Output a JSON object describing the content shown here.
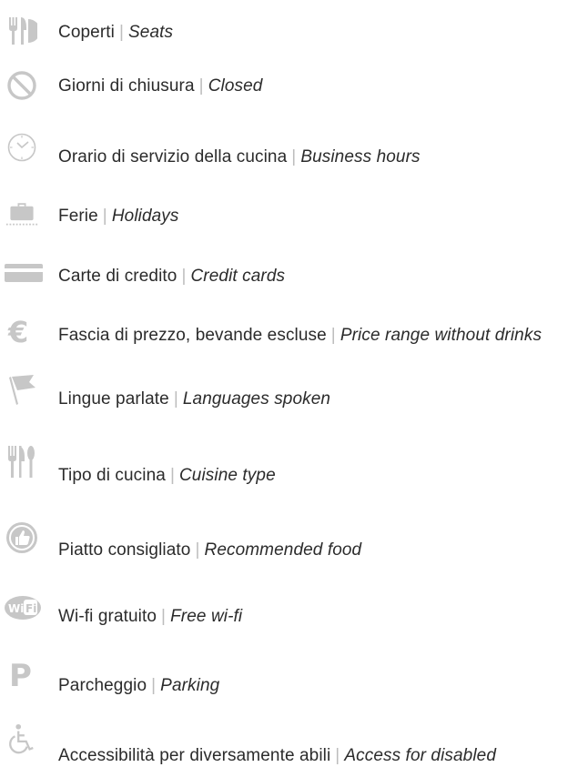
{
  "colors": {
    "icon": "#c7c7c7",
    "text": "#2b2b2b",
    "separator": "#bdbdbd"
  },
  "legend": [
    {
      "icon": "fork-knife-plate-icon",
      "it": "Coperti",
      "en": "Seats"
    },
    {
      "icon": "no-entry-icon",
      "it": "Giorni di chiusura",
      "en": "Closed"
    },
    {
      "icon": "clock-icon",
      "it": "Orario di servizio della cucina",
      "en": "Business hours"
    },
    {
      "icon": "suitcase-icon",
      "it": "Ferie",
      "en": "Holidays"
    },
    {
      "icon": "credit-card-icon",
      "it": "Carte di credito",
      "en": "Credit cards"
    },
    {
      "icon": "euro-icon",
      "it": "Fascia di prezzo, bevande escluse",
      "en": "Price range without drinks"
    },
    {
      "icon": "flag-icon",
      "it": "Lingue parlate",
      "en": "Languages spoken"
    },
    {
      "icon": "cutlery-icon",
      "it": "Tipo di cucina",
      "en": "Cuisine type"
    },
    {
      "icon": "thumbs-up-icon",
      "it": "Piatto consigliato",
      "en": "Recommended food"
    },
    {
      "icon": "wifi-icon",
      "it": "Wi-fi gratuito",
      "en": "Free wi-fi"
    },
    {
      "icon": "parking-icon",
      "it": "Parcheggio",
      "en": "Parking"
    },
    {
      "icon": "wheelchair-icon",
      "it": "Accessibilità per diversamente abili",
      "en": "Access for disabled"
    }
  ]
}
